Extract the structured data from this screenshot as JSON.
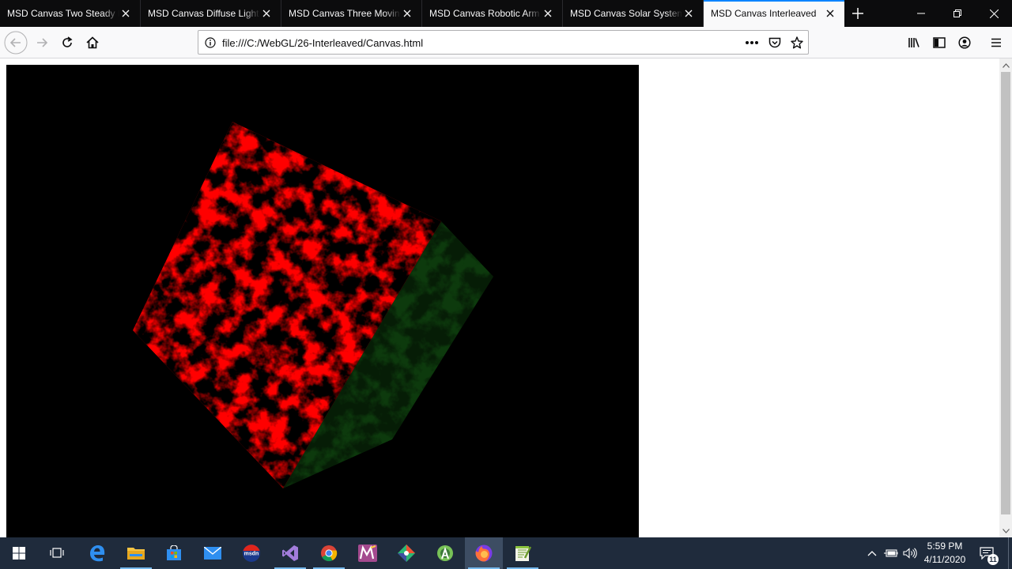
{
  "browser": {
    "tabs": [
      {
        "label": "MSD Canvas Two Steady Lights",
        "active": false
      },
      {
        "label": "MSD Canvas Diffuse Lighting",
        "active": false
      },
      {
        "label": "MSD Canvas Three Moving Lights",
        "active": false
      },
      {
        "label": "MSD Canvas Robotic Arm",
        "active": false
      },
      {
        "label": "MSD Canvas Solar System",
        "active": false
      },
      {
        "label": "MSD Canvas Interleaved",
        "active": true
      }
    ],
    "url": "file:///C:/WebGL/26-Interleaved/Canvas.html",
    "icons": [
      "back-icon",
      "forward-icon",
      "reload-icon",
      "home-icon",
      "info-icon",
      "page-actions-icon",
      "pocket-icon",
      "bookmark-star-icon",
      "library-icon",
      "sidebar-icon",
      "account-icon",
      "menu-icon"
    ]
  },
  "page": {
    "canvas_background": "#000000",
    "cube_front_color": "#ff0000",
    "cube_side_color": "#0d3a0d"
  },
  "taskbar": {
    "apps": [
      "start-icon",
      "task-view-icon",
      "edge-icon",
      "file-explorer-icon",
      "store-icon",
      "mail-icon",
      "msdn-icon",
      "visual-studio-icon",
      "chrome-icon",
      "notepad-app-icon",
      "git-icon",
      "android-studio-icon",
      "firefox-icon",
      "notepadpp-icon"
    ],
    "msdn_text": "msdn",
    "clock_time": "5:59 PM",
    "clock_date": "4/11/2020",
    "notification_count": "11"
  }
}
